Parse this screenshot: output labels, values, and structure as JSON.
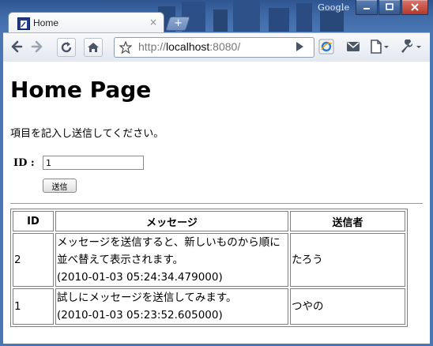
{
  "browser": {
    "tab_title": "Home",
    "tab_close_glyph": "×",
    "new_tab_glyph": "+",
    "google_mark": "Google",
    "url_scheme": "http://",
    "url_host": "localhost",
    "url_port": ":8080/",
    "toolbar_icons": [
      "back-icon",
      "forward-icon",
      "reload-icon",
      "home-icon",
      "star-icon",
      "go-icon",
      "ie-tab-icon",
      "mail-icon",
      "page-menu-icon",
      "wrench-menu-icon"
    ]
  },
  "page": {
    "title": "Home Page",
    "instruction": "項目を記入し送信してください。",
    "id_label": "ID :",
    "id_value": "1",
    "submit_label": "送信"
  },
  "table": {
    "headers": [
      "ID",
      "メッセージ",
      "送信者"
    ],
    "rows": [
      {
        "id": "2",
        "message": "メッセージを送信すると、新しいものから順に並べ替えて表示されます。",
        "timestamp": "(2010-01-03 05:24:34.479000)",
        "sender": "たろう"
      },
      {
        "id": "1",
        "message": "試しにメッセージを送信してみます。",
        "timestamp": "(2010-01-03 05:23:52.605000)",
        "sender": "つやの"
      }
    ]
  }
}
